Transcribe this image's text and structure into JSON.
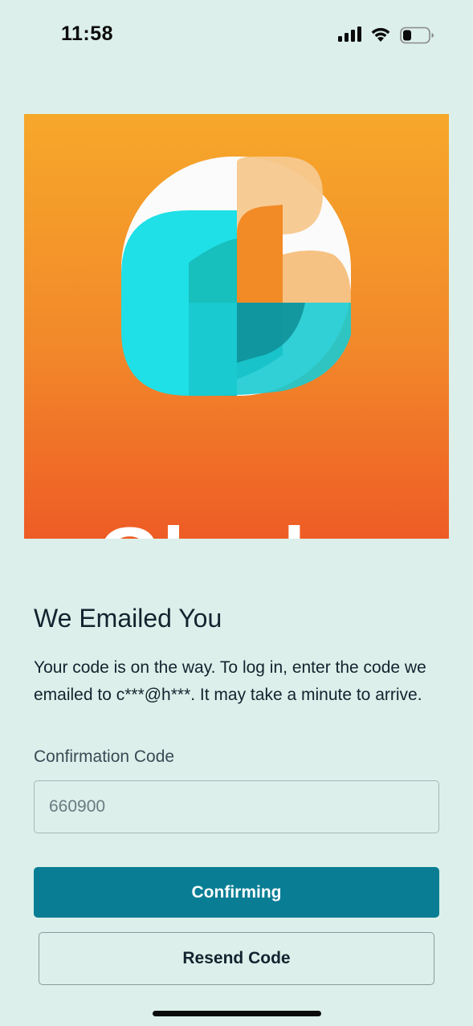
{
  "status_bar": {
    "time": "11:58",
    "icons": [
      "signal-icon",
      "wifi-icon",
      "battery-icon"
    ]
  },
  "logo": {
    "brand_text": "Glyphz"
  },
  "confirm": {
    "heading": "We Emailed You",
    "description": "Your code is on the way. To log in, enter the code we emailed to c***@h***. It may take a minute to arrive.",
    "field_label": "Confirmation Code",
    "code_value": "660900",
    "confirm_button": "Confirming",
    "resend_button": "Resend Code"
  },
  "colors": {
    "background": "#dcefea",
    "primary": "#087d94",
    "logo_orange": "#f2882a",
    "logo_teal": "#1fd6d9"
  }
}
